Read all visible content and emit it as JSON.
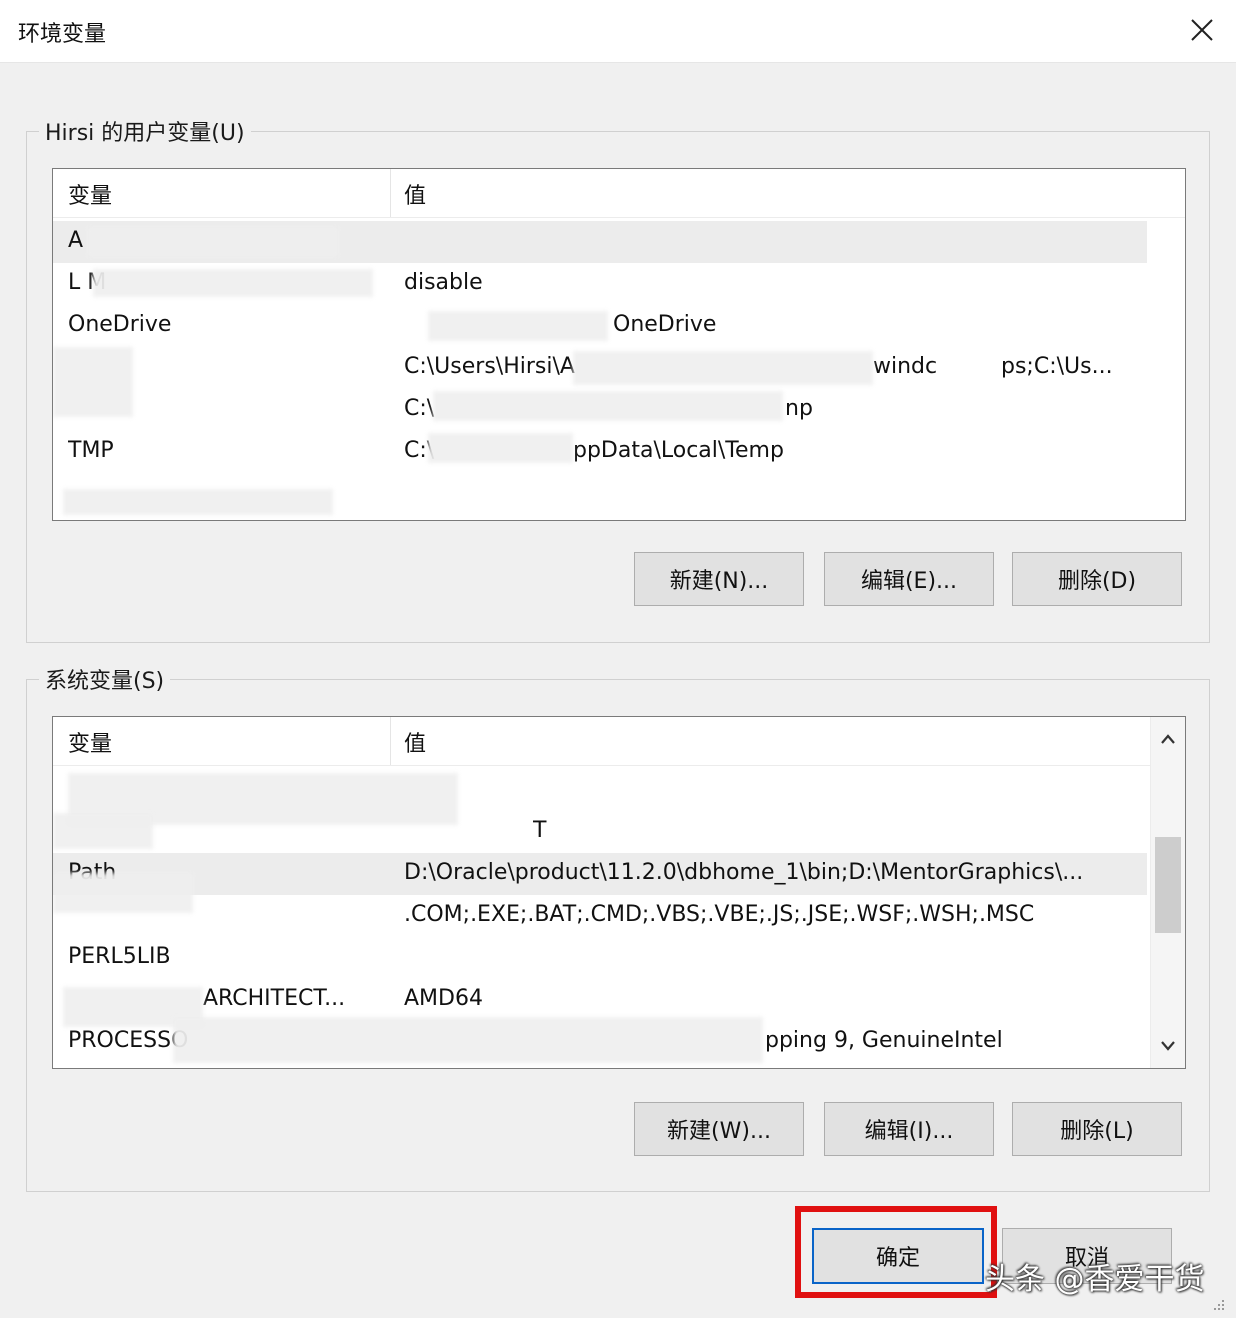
{
  "window": {
    "title": "环境变量",
    "close_icon": "close-icon"
  },
  "user_vars": {
    "group_label": "Hirsi 的用户变量(U)",
    "col_name": "变量",
    "col_value": "值",
    "rows": [
      {
        "name": "A",
        "value": ""
      },
      {
        "name": "L M",
        "value": "disable"
      },
      {
        "name": "OneDrive",
        "value": "OneDrive"
      },
      {
        "name": "",
        "value": "C:\\Users\\Hirsi\\A",
        "value_tail": "windc",
        "value_tail2": "ps;C:\\Us..."
      },
      {
        "name": "",
        "value": "C:\\",
        "value_tail": "np"
      },
      {
        "name": "TMP",
        "value": "C:\\",
        "value_tail": "ppData\\Local\\Temp"
      }
    ],
    "buttons": {
      "new": "新建(N)...",
      "edit": "编辑(E)...",
      "delete": "删除(D)"
    }
  },
  "system_vars": {
    "group_label": "系统变量(S)",
    "col_name": "变量",
    "col_value": "值",
    "rows": [
      {
        "name": "",
        "value": ""
      },
      {
        "name": "",
        "value": "T"
      },
      {
        "name": "Path",
        "value": "D:\\Oracle\\product\\11.2.0\\dbhome_1\\bin;D:\\MentorGraphics\\..."
      },
      {
        "name": "",
        "value": ".COM;.EXE;.BAT;.CMD;.VBS;.VBE;.JS;.JSE;.WSF;.WSH;.MSC"
      },
      {
        "name": "PERL5LIB",
        "value": ""
      },
      {
        "name": "ARCHITECT...",
        "value": "AMD64"
      },
      {
        "name": "PROCESSO",
        "value": "pping 9, GenuineIntel"
      }
    ],
    "buttons": {
      "new": "新建(W)...",
      "edit": "编辑(I)...",
      "delete": "删除(L)"
    }
  },
  "footer": {
    "ok": "确定",
    "cancel": "取消"
  },
  "watermark": "头条 @香爱干货",
  "colors": {
    "highlight": "#e01010",
    "ok_border": "#0a64c8"
  }
}
